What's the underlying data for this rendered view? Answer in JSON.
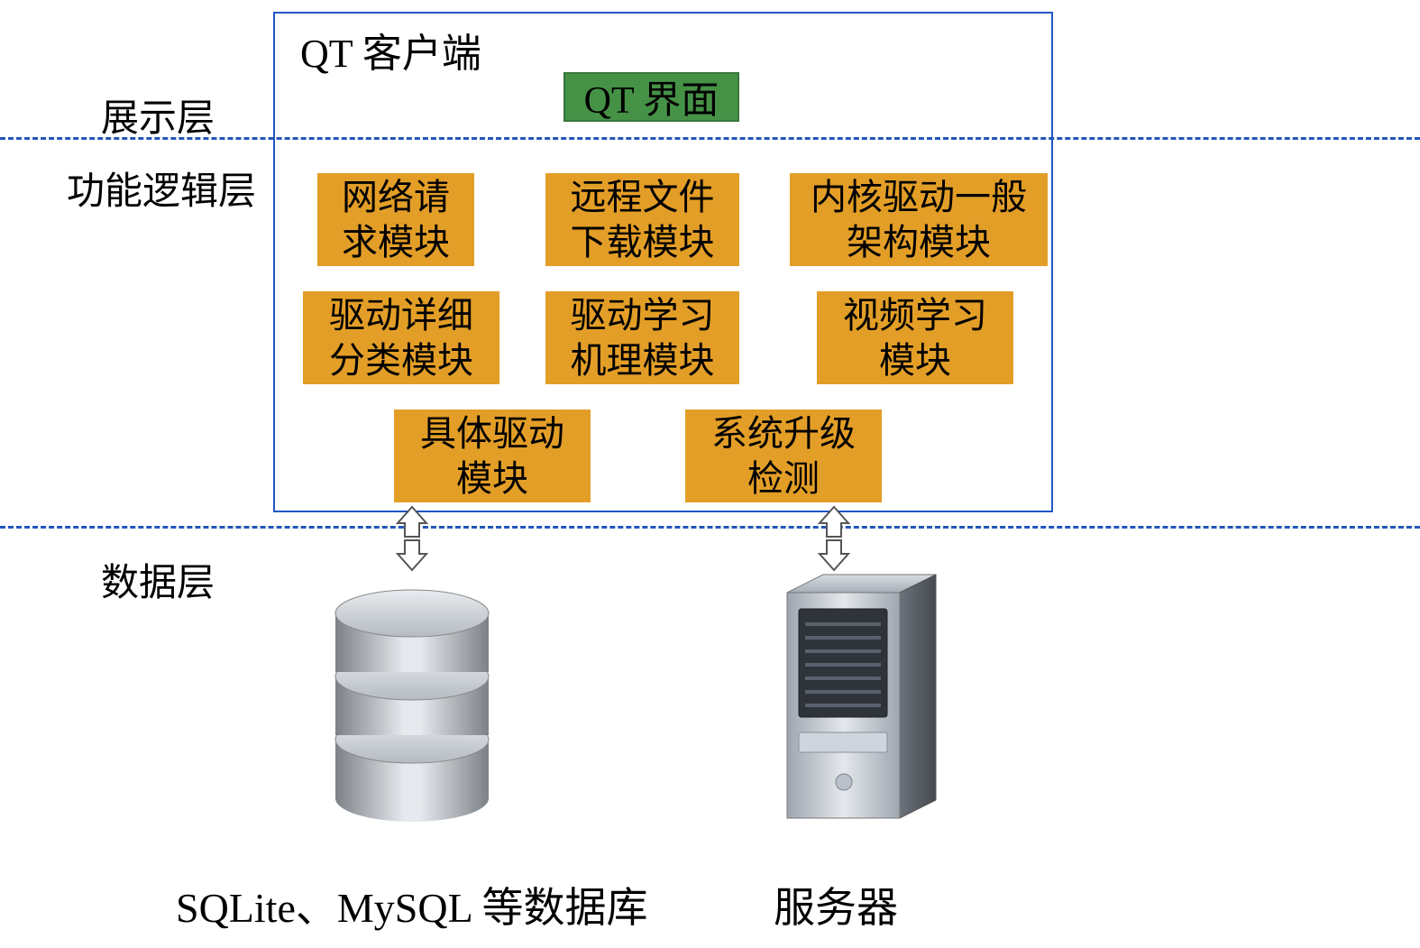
{
  "layers": {
    "presentation": "展示层",
    "logic": "功能逻辑层",
    "data": "数据层"
  },
  "client": {
    "title": "QT 客户端",
    "ui_box": "QT 界面"
  },
  "modules": {
    "network_request": "网络请\n求模块",
    "remote_file_download": "远程文件\n下载模块",
    "kernel_driver_general": "内核驱动一般\n架构模块",
    "driver_detail_category": "驱动详细\n分类模块",
    "driver_learning_mechanism": "驱动学习\n机理模块",
    "video_learning": "视频学习\n模块",
    "specific_driver": "具体驱动\n模块",
    "system_upgrade_check": "系统升级\n检测"
  },
  "data_layer": {
    "database_label": "SQLite、MySQL 等数据库",
    "server_label": "服务器"
  },
  "colors": {
    "module_bg": "#e39e27",
    "ui_bg": "#459247",
    "border_blue": "#2156c4",
    "dashed_blue": "#2455bb"
  }
}
